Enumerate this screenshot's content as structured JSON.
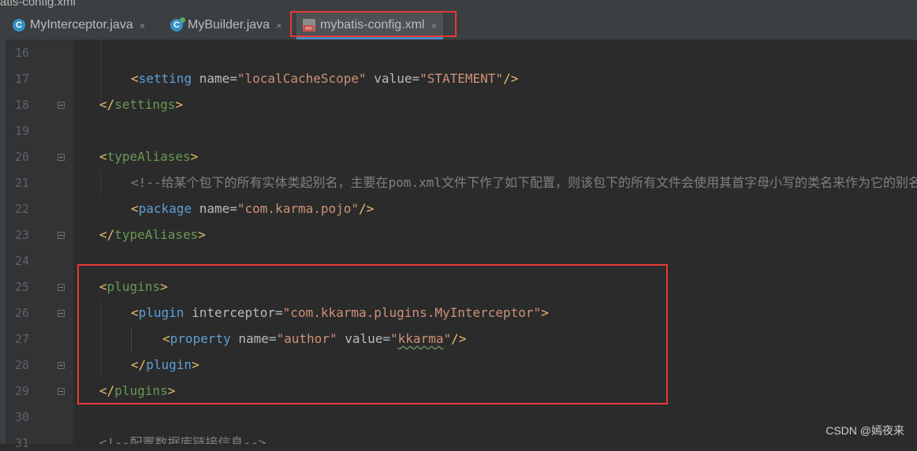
{
  "window": {
    "title": "atis-config.xml"
  },
  "tabs": [
    {
      "label": "MyInterceptor.java",
      "icon": "java-class-icon",
      "active": false
    },
    {
      "label": "MyBuilder.java",
      "icon": "java-class-icon",
      "active": false
    },
    {
      "label": "mybatis-config.xml",
      "icon": "xml-file-icon",
      "active": true
    }
  ],
  "close_glyph": "×",
  "colors": {
    "highlight_box": "#e53935",
    "editor_bg": "#2b2b2b",
    "tag_name": "#5c9fd6",
    "string_value": "#ce9178"
  },
  "lines": [
    {
      "num": "16",
      "parts": []
    },
    {
      "num": "17",
      "parts": [
        {
          "t": "<",
          "c": "tag"
        },
        {
          "t": "setting",
          "c": "blue"
        },
        {
          "t": " name",
          "c": "attr"
        },
        {
          "t": "=",
          "c": "plain"
        },
        {
          "t": "\"localCacheScope\"",
          "c": "str"
        },
        {
          "t": " value",
          "c": "attr"
        },
        {
          "t": "=",
          "c": "plain"
        },
        {
          "t": "\"STATEMENT\"",
          "c": "str"
        },
        {
          "t": "/>",
          "c": "tag"
        }
      ]
    },
    {
      "num": "18",
      "parts": [
        {
          "t": "</",
          "c": "tag"
        },
        {
          "t": "settings",
          "c": "green"
        },
        {
          "t": ">",
          "c": "tag"
        }
      ]
    },
    {
      "num": "19",
      "parts": []
    },
    {
      "num": "20",
      "parts": [
        {
          "t": "<",
          "c": "tag"
        },
        {
          "t": "typeAliases",
          "c": "green"
        },
        {
          "t": ">",
          "c": "tag"
        }
      ]
    },
    {
      "num": "21",
      "parts": [
        {
          "t": "<!--给某个包下的所有实体类起别名，主要在pom.xml文件下作了如下配置，则该包下的所有文件会使用其首字母小写的类名来作为它的别名",
          "c": "cmt"
        }
      ]
    },
    {
      "num": "22",
      "parts": [
        {
          "t": "<",
          "c": "tag"
        },
        {
          "t": "package",
          "c": "blue"
        },
        {
          "t": " name",
          "c": "attr"
        },
        {
          "t": "=",
          "c": "plain"
        },
        {
          "t": "\"com.karma.pojo\"",
          "c": "str"
        },
        {
          "t": "/>",
          "c": "tag"
        }
      ]
    },
    {
      "num": "23",
      "parts": [
        {
          "t": "</",
          "c": "tag"
        },
        {
          "t": "typeAliases",
          "c": "green"
        },
        {
          "t": ">",
          "c": "tag"
        }
      ]
    },
    {
      "num": "24",
      "parts": []
    },
    {
      "num": "25",
      "parts": [
        {
          "t": "<",
          "c": "tag"
        },
        {
          "t": "plugins",
          "c": "green"
        },
        {
          "t": ">",
          "c": "tag"
        }
      ]
    },
    {
      "num": "26",
      "parts": [
        {
          "t": "<",
          "c": "tag"
        },
        {
          "t": "plugin",
          "c": "blue"
        },
        {
          "t": " interceptor",
          "c": "attr"
        },
        {
          "t": "=",
          "c": "plain"
        },
        {
          "t": "\"com.kkarma.plugins.MyInterceptor\"",
          "c": "str"
        },
        {
          "t": ">",
          "c": "tag"
        }
      ]
    },
    {
      "num": "27",
      "parts": [
        {
          "t": "<",
          "c": "tag"
        },
        {
          "t": "property",
          "c": "blue"
        },
        {
          "t": " name",
          "c": "attr"
        },
        {
          "t": "=",
          "c": "plain"
        },
        {
          "t": "\"author\"",
          "c": "str"
        },
        {
          "t": " value",
          "c": "attr"
        },
        {
          "t": "=",
          "c": "plain"
        },
        {
          "t": "\"kkarma\"",
          "c": "str"
        },
        {
          "t": "/>",
          "c": "tag"
        }
      ]
    },
    {
      "num": "28",
      "parts": [
        {
          "t": "</",
          "c": "tag"
        },
        {
          "t": "plugin",
          "c": "blue"
        },
        {
          "t": ">",
          "c": "tag"
        }
      ]
    },
    {
      "num": "29",
      "parts": [
        {
          "t": "</",
          "c": "tag"
        },
        {
          "t": "plugins",
          "c": "green"
        },
        {
          "t": ">",
          "c": "tag"
        }
      ]
    },
    {
      "num": "30",
      "parts": []
    },
    {
      "num": "31",
      "parts": [
        {
          "t": "<!--配置数据库链接信息-->",
          "c": "cmt"
        }
      ]
    }
  ],
  "watermark": "CSDN @嫣夜来"
}
